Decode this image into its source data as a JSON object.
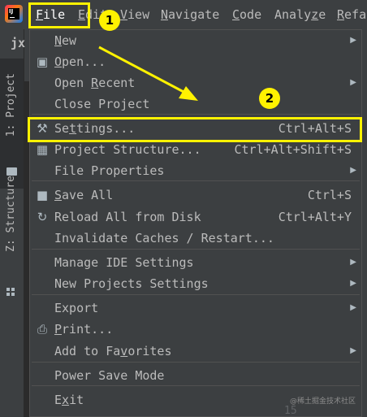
{
  "app": {
    "logo_text": "IJ"
  },
  "menubar": [
    {
      "key": "file",
      "pre": "",
      "mn": "F",
      "post": "ile"
    },
    {
      "key": "edit",
      "pre": "",
      "mn": "E",
      "post": "dit"
    },
    {
      "key": "view",
      "pre": "",
      "mn": "V",
      "post": "iew"
    },
    {
      "key": "navigate",
      "pre": "",
      "mn": "N",
      "post": "avigate"
    },
    {
      "key": "code",
      "pre": "",
      "mn": "C",
      "post": "ode"
    },
    {
      "key": "analyze",
      "pre": "Analy",
      "mn": "z",
      "post": "e"
    },
    {
      "key": "refactor",
      "pre": "",
      "mn": "R",
      "post": "efa"
    }
  ],
  "sidebar": {
    "project_tab": "1: Project",
    "structure_tab": "Z: Structure",
    "project_short": "jx"
  },
  "file_menu": {
    "items": [
      {
        "pre": "",
        "mn": "N",
        "post": "ew",
        "shortcut": "",
        "submenu": true,
        "icon": ""
      },
      {
        "pre": "",
        "mn": "O",
        "post": "pen...",
        "shortcut": "",
        "submenu": false,
        "icon": "folder-open-icon"
      },
      {
        "pre": "Open ",
        "mn": "R",
        "post": "ecent",
        "shortcut": "",
        "submenu": true,
        "icon": ""
      },
      {
        "pre": "Close Project",
        "mn": "",
        "post": "",
        "shortcut": "",
        "submenu": false,
        "icon": ""
      },
      {
        "pre": "Se",
        "mn": "t",
        "post": "tings...",
        "shortcut": "Ctrl+Alt+S",
        "submenu": false,
        "icon": "wrench-icon",
        "selected": true
      },
      {
        "pre": "Project Structure...",
        "mn": "",
        "post": "",
        "shortcut": "Ctrl+Alt+Shift+S",
        "submenu": false,
        "icon": "project-structure-icon"
      },
      {
        "pre": "File Properties",
        "mn": "",
        "post": "",
        "shortcut": "",
        "submenu": true,
        "icon": ""
      },
      {
        "pre": "",
        "mn": "S",
        "post": "ave All",
        "shortcut": "Ctrl+S",
        "submenu": false,
        "icon": "save-all-icon"
      },
      {
        "pre": "Reload All from Disk",
        "mn": "",
        "post": "",
        "shortcut": "Ctrl+Alt+Y",
        "submenu": false,
        "icon": "reload-icon"
      },
      {
        "pre": "Invalidate Caches / Restart...",
        "mn": "",
        "post": "",
        "shortcut": "",
        "submenu": false,
        "icon": ""
      },
      {
        "pre": "Manage IDE Settings",
        "mn": "",
        "post": "",
        "shortcut": "",
        "submenu": true,
        "icon": ""
      },
      {
        "pre": "New Projects Settings",
        "mn": "",
        "post": "",
        "shortcut": "",
        "submenu": true,
        "icon": ""
      },
      {
        "pre": "Export",
        "mn": "",
        "post": "",
        "shortcut": "",
        "submenu": true,
        "icon": ""
      },
      {
        "pre": "",
        "mn": "P",
        "post": "rint...",
        "shortcut": "",
        "submenu": false,
        "icon": "printer-icon"
      },
      {
        "pre": "Add to Fa",
        "mn": "v",
        "post": "orites",
        "shortcut": "",
        "submenu": true,
        "icon": ""
      },
      {
        "pre": "Power Save Mode",
        "mn": "",
        "post": "",
        "shortcut": "",
        "submenu": false,
        "icon": ""
      },
      {
        "pre": "E",
        "mn": "x",
        "post": "it",
        "shortcut": "",
        "submenu": false,
        "icon": ""
      }
    ]
  },
  "annotations": {
    "badge1": "1",
    "badge2": "2"
  },
  "watermark": "@稀土掘金技术社区",
  "gutter_line": "15",
  "colors": {
    "highlight": "#fff200",
    "selection": "#4b6eaf",
    "menu_bg": "#3c3f41"
  }
}
